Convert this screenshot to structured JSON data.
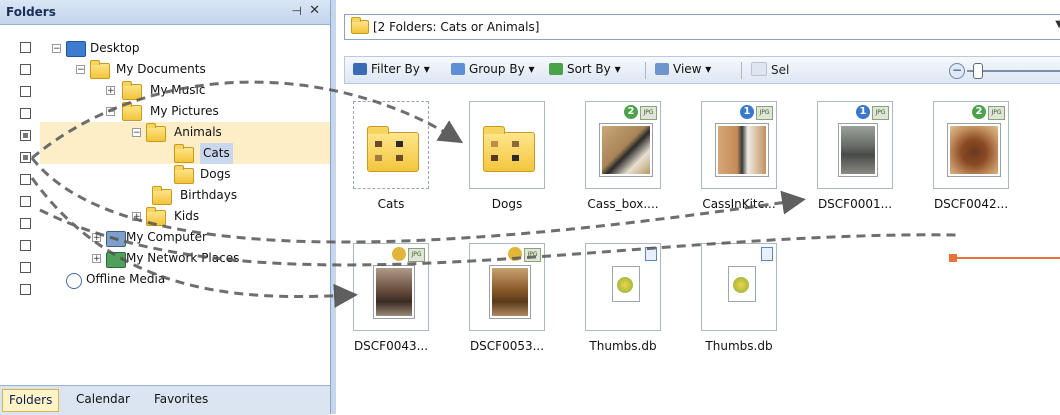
{
  "folders_panel": {
    "title": "Folders",
    "pin_glyph": "⊣",
    "close_glyph": "✕",
    "tree": [
      {
        "label": "Desktop",
        "icon": "desktop-icon"
      },
      {
        "label": "My Documents",
        "icon": "documents-folder-icon"
      },
      {
        "label": "My Music",
        "icon": "music-folder-icon"
      },
      {
        "label": "My Pictures",
        "icon": "pictures-folder-icon"
      },
      {
        "label": "Animals",
        "icon": "folder-icon"
      },
      {
        "label": "Cats",
        "icon": "folder-icon"
      },
      {
        "label": "Dogs",
        "icon": "folder-icon"
      },
      {
        "label": "Birthdays",
        "icon": "folder-icon"
      },
      {
        "label": "Kids",
        "icon": "folder-icon"
      },
      {
        "label": "My Computer",
        "icon": "computer-icon"
      },
      {
        "label": "My Network Places",
        "icon": "network-icon"
      },
      {
        "label": "Offline Media",
        "icon": "offline-media-icon"
      }
    ],
    "tabs": [
      "Folders",
      "Calendar",
      "Favorites"
    ]
  },
  "address_bar": {
    "text": "[2 Folders: Cats or Animals]"
  },
  "toolbar": {
    "filter_by": "Filter By",
    "group_by": "Group By",
    "sort_by": "Sort By",
    "view": "View",
    "select": "Sel"
  },
  "items": [
    {
      "name": "Cats",
      "type": "folder"
    },
    {
      "name": "Dogs",
      "type": "folder"
    },
    {
      "name": "Cass_box....",
      "type": "photo",
      "badge": "2",
      "badge_color": "#4aa34a"
    },
    {
      "name": "CassInKitc...",
      "type": "photo",
      "badge": "1",
      "badge_color": "#3a78c9"
    },
    {
      "name": "DSCF0001...",
      "type": "photo",
      "badge": "1",
      "badge_color": "#3a78c9"
    },
    {
      "name": "DSCF0042...",
      "type": "photo",
      "badge": "2",
      "badge_color": "#4aa34a"
    },
    {
      "name": "DSCF0043...",
      "type": "photo",
      "badge": "",
      "badge_color": "#e0b53a"
    },
    {
      "name": "DSCF0053...",
      "type": "photo",
      "badge": "",
      "badge_color": "#e0b53a"
    },
    {
      "name": "Thumbs.db",
      "type": "db"
    },
    {
      "name": "Thumbs.db",
      "type": "db"
    }
  ],
  "jpg_tag": "JPG",
  "colors": {
    "selection": "#fdeec8",
    "accent_line": "#e8733a",
    "panel_border": "#8aa4c8"
  }
}
